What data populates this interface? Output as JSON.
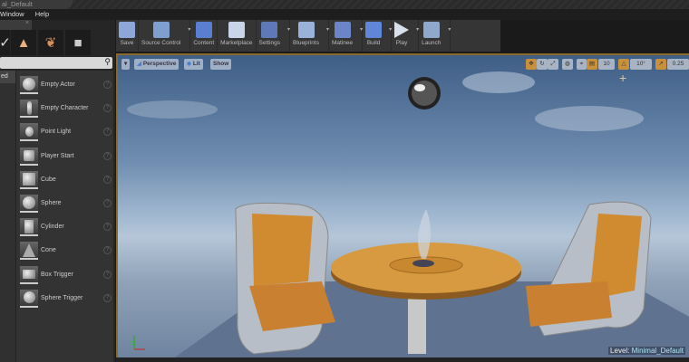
{
  "window": {
    "title": "al_Default"
  },
  "menu": [
    "Window",
    "Help"
  ],
  "left_panel": {
    "search_placeholder": "",
    "category_selected": "ed",
    "items": [
      {
        "label": "Empty Actor"
      },
      {
        "label": "Empty Character"
      },
      {
        "label": "Point Light"
      },
      {
        "label": "Player Start"
      },
      {
        "label": "Cube"
      },
      {
        "label": "Sphere"
      },
      {
        "label": "Cylinder"
      },
      {
        "label": "Cone"
      },
      {
        "label": "Box Trigger"
      },
      {
        "label": "Sphere Trigger"
      }
    ]
  },
  "toolbar": [
    {
      "label": "Save",
      "color": "#8fa6d8"
    },
    {
      "label": "Source Control",
      "color": "#7f9fcf"
    },
    {
      "label": "Content",
      "color": "#5a7fd0"
    },
    {
      "label": "Marketplace",
      "color": "#c8d4e8"
    },
    {
      "label": "Settings",
      "color": "#5d79b8"
    },
    {
      "label": "Blueprints",
      "color": "#9ab2da"
    },
    {
      "label": "Matinee",
      "color": "#6a86c8"
    },
    {
      "label": "Build",
      "color": "#5f86d8"
    },
    {
      "label": "Play",
      "color": "#d8e0ec"
    },
    {
      "label": "Launch",
      "color": "#8fa8cc"
    }
  ],
  "viewport": {
    "perspective": "Perspective",
    "lit": "Lit",
    "show": "Show",
    "grid_snap": "10",
    "rotation_snap": "10°",
    "scale_snap": "0.25",
    "level_label": "Level:",
    "level_name": "Minimal_Default"
  }
}
